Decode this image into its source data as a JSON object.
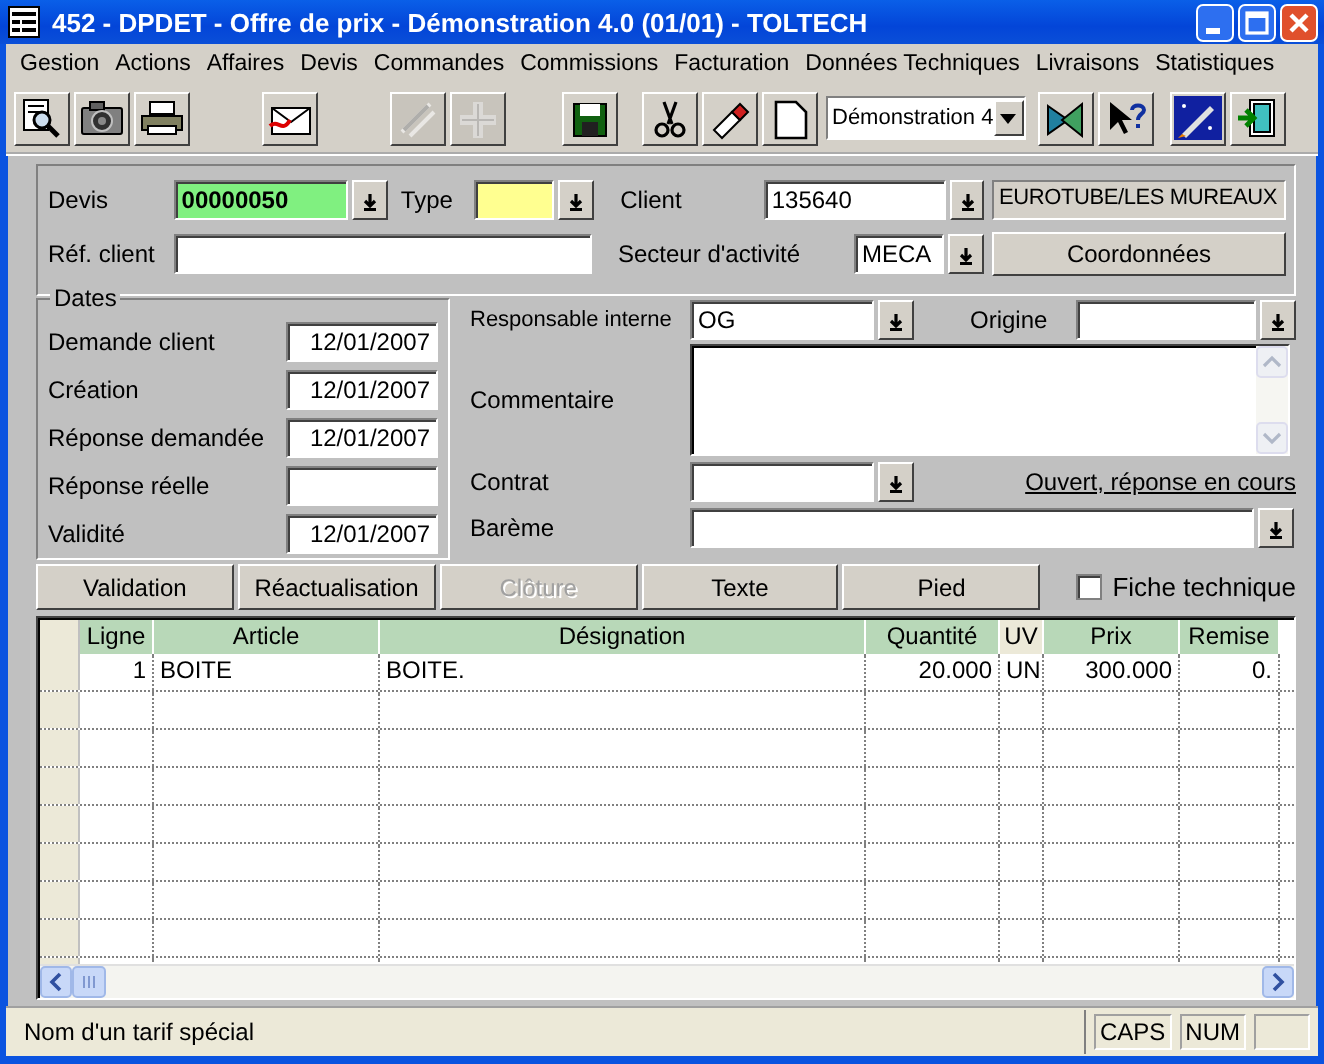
{
  "window": {
    "title": "452 - DPDET - Offre de prix - Démonstration 4.0 (01/01) - TOLTECH"
  },
  "menu": [
    "Gestion",
    "Actions",
    "Affaires",
    "Devis",
    "Commandes",
    "Commissions",
    "Facturation",
    "Données Techniques",
    "Livraisons",
    "Statistiques"
  ],
  "toolbar": {
    "buttons": [
      {
        "disabled": false
      },
      {
        "disabled": false
      },
      {
        "disabled": false
      },
      {
        "disabled": false
      },
      {
        "disabled": true
      },
      {
        "disabled": true
      },
      {
        "disabled": false
      },
      {
        "disabled": false
      },
      {
        "disabled": false
      },
      {
        "disabled": false
      }
    ],
    "combo": "Démonstration 4",
    "buttons_right": [
      {
        "disabled": false
      },
      {
        "disabled": false
      },
      {
        "disabled": false
      },
      {
        "disabled": false
      }
    ]
  },
  "header": {
    "devis_label": "Devis",
    "devis": "00000050",
    "type_label": "Type",
    "client_label": "Client",
    "client": "135640",
    "client_name": "EUROTUBE/LES MUREAUX",
    "ref_label": "Réf. client",
    "secteur_label": "Secteur d'activité",
    "secteur": "MECA",
    "coordonnees_button": "Coordonnées"
  },
  "dates": {
    "title": "Dates",
    "rows": [
      {
        "label": "Demande client",
        "value": "12/01/2007"
      },
      {
        "label": "Création",
        "value": "12/01/2007"
      },
      {
        "label": "Réponse demandée",
        "value": "12/01/2007"
      },
      {
        "label": "Réponse réelle"
      },
      {
        "label": "Validité",
        "value": "12/01/2007"
      }
    ]
  },
  "details": {
    "responsable_label": "Responsable interne",
    "responsable": "OG",
    "origine_label": "Origine",
    "commentaire_label": "Commentaire",
    "contrat_label": "Contrat",
    "status_link": "Ouvert, réponse en cours",
    "bareme_label": "Barème"
  },
  "actions": [
    {
      "label": "Validation",
      "disabled": false
    },
    {
      "label": "Réactualisation",
      "disabled": false
    },
    {
      "label": "Clôture",
      "disabled": true
    },
    {
      "label": "Texte",
      "disabled": false
    },
    {
      "label": "Pied",
      "disabled": false
    }
  ],
  "fiche_technique": {
    "label": "Fiche technique",
    "checked": false
  },
  "table": {
    "columns": [
      "Ligne",
      "Article",
      "Désignation",
      "Quantité",
      "UV",
      "Prix",
      "Remise"
    ],
    "rows": [
      [
        "1",
        "BOITE",
        "BOITE.",
        "20.000",
        "UN",
        "300.000",
        "0."
      ]
    ]
  },
  "status_bar": {
    "message": "Nom d'un tarif spécial",
    "indicators": [
      "CAPS",
      "NUM"
    ]
  }
}
